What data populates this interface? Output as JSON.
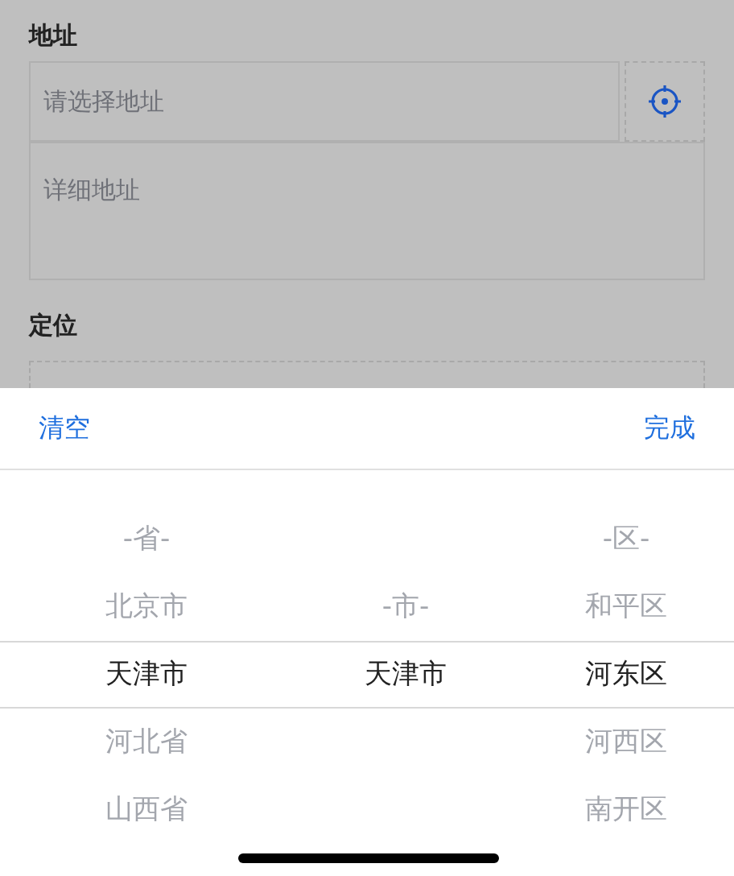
{
  "form": {
    "address_label": "地址",
    "address_field": {
      "placeholder": "请选择地址"
    },
    "detail_field": {
      "placeholder": "详细地址"
    },
    "location_label": "定位"
  },
  "picker": {
    "clear_button": "清空",
    "done_button": "完成",
    "columns": [
      {
        "items": [
          {
            "label": "-省-",
            "selected": false
          },
          {
            "label": "北京市",
            "selected": false
          },
          {
            "label": "天津市",
            "selected": true
          },
          {
            "label": "河北省",
            "selected": false
          },
          {
            "label": "山西省",
            "selected": false
          }
        ]
      },
      {
        "items": [
          {
            "label": "-市-",
            "selected": false
          },
          {
            "label": "天津市",
            "selected": true
          }
        ]
      },
      {
        "items": [
          {
            "label": "-区-",
            "selected": false
          },
          {
            "label": "和平区",
            "selected": false
          },
          {
            "label": "河东区",
            "selected": true
          },
          {
            "label": "河西区",
            "selected": false
          },
          {
            "label": "南开区",
            "selected": false
          }
        ]
      }
    ]
  }
}
